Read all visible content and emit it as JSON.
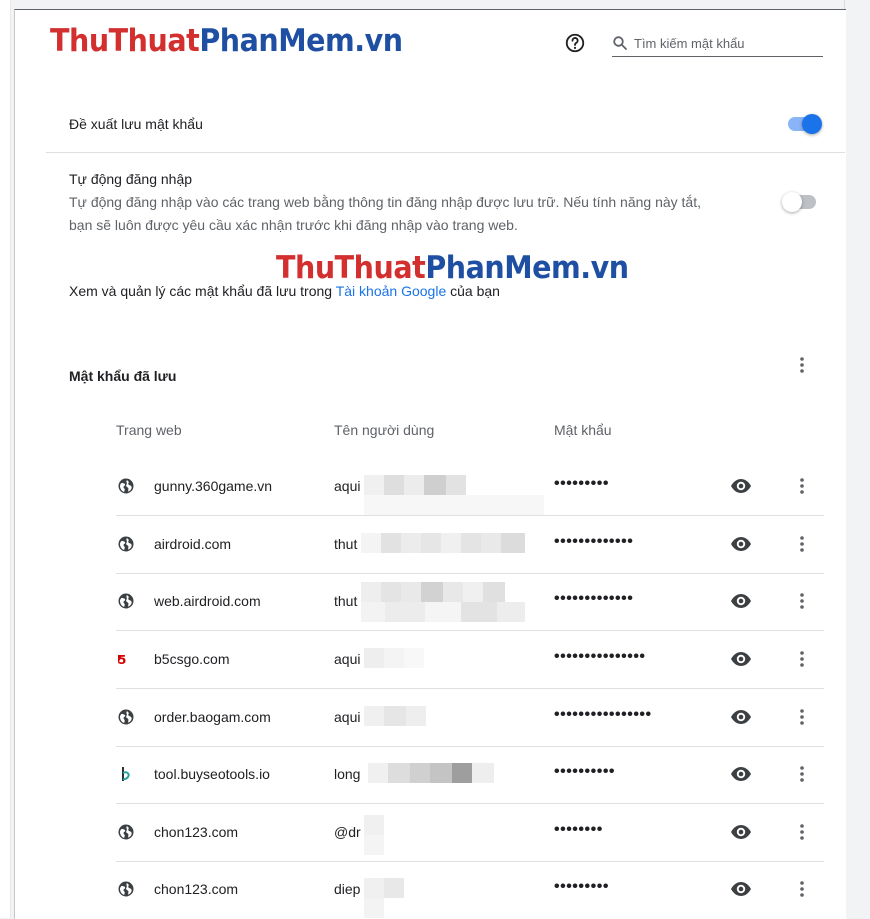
{
  "watermark": {
    "red": "ThuThuat",
    "blue": "PhanMem.vn"
  },
  "header": {
    "search_placeholder": "Tìm kiếm mật khẩu",
    "help_icon": "help-circle-icon",
    "search_icon": "search-icon"
  },
  "settings": {
    "offer_to_save": {
      "label": "Đề xuất lưu mật khẩu",
      "enabled": true
    },
    "auto_signin": {
      "label": "Tự động đăng nhập",
      "desc_line1": "Tự động đăng nhập vào các trang web bằng thông tin đăng nhập được lưu trữ. Nếu tính năng này tắt,",
      "desc_line2": "bạn sẽ luôn được yêu cầu xác nhận trước khi đăng nhập vào trang web.",
      "enabled": false
    },
    "manage": {
      "prefix": "Xem và quản lý các mật khẩu đã lưu trong ",
      "link": "Tài khoản Google",
      "suffix": " của bạn"
    }
  },
  "saved_passwords": {
    "title": "Mật khẩu đã lưu",
    "columns": [
      "Trang web",
      "Tên người dùng",
      "Mật khẩu"
    ],
    "rows": [
      {
        "site": "gunny.360game.vn",
        "icon": "globe-icon",
        "user": "aqui",
        "password": "•••••••••"
      },
      {
        "site": "airdroid.com",
        "icon": "globe-icon",
        "user": "thut",
        "password": "•••••••••••••"
      },
      {
        "site": "web.airdroid.com",
        "icon": "globe-icon",
        "user": "thut",
        "password": "•••••••••••••"
      },
      {
        "site": "b5csgo.com",
        "icon": "b5csgo-favicon",
        "user": "aqui",
        "password": "•••••••••••••••"
      },
      {
        "site": "order.baogam.com",
        "icon": "globe-icon",
        "user": "aqui",
        "password": "••••••••••••••••"
      },
      {
        "site": "tool.buyseotools.io",
        "icon": "buyseotools-favicon",
        "user": "long",
        "password": "••••••••••"
      },
      {
        "site": "chon123.com",
        "icon": "globe-icon",
        "user": "@dr",
        "password": "••••••••"
      },
      {
        "site": "chon123.com",
        "icon": "globe-icon",
        "user": "diep",
        "password": "•••••••••"
      }
    ]
  },
  "colors": {
    "accent": "#1a73e8",
    "toggle_track_on": "#8ab4f8",
    "watermark_red": "#d32f2f",
    "watermark_blue": "#1e4fa3"
  }
}
